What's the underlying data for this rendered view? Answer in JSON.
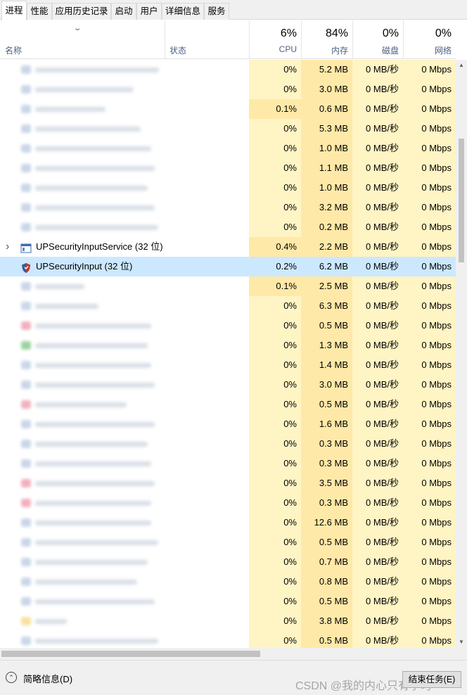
{
  "tabs": [
    {
      "label": "进程",
      "active": true
    },
    {
      "label": "性能"
    },
    {
      "label": "应用历史记录"
    },
    {
      "label": "启动"
    },
    {
      "label": "用户"
    },
    {
      "label": "详细信息"
    },
    {
      "label": "服务"
    }
  ],
  "header": {
    "name_label": "名称",
    "status_label": "状态",
    "cpu": {
      "pct": "6%",
      "label": "CPU"
    },
    "mem": {
      "pct": "84%",
      "label": "内存"
    },
    "disk": {
      "pct": "0%",
      "label": "磁盘"
    },
    "net": {
      "pct": "0%",
      "label": "网络"
    }
  },
  "rows": [
    {
      "cpu": "0%",
      "mem": "5.2 MB",
      "disk": "0 MB/秒",
      "net": "0 Mbps",
      "blurred": true
    },
    {
      "cpu": "0%",
      "mem": "3.0 MB",
      "disk": "0 MB/秒",
      "net": "0 Mbps",
      "blurred": true
    },
    {
      "cpu": "0.1%",
      "mem": "0.6 MB",
      "disk": "0 MB/秒",
      "net": "0 Mbps",
      "blurred": true
    },
    {
      "cpu": "0%",
      "mem": "5.3 MB",
      "disk": "0 MB/秒",
      "net": "0 Mbps",
      "blurred": true
    },
    {
      "cpu": "0%",
      "mem": "1.0 MB",
      "disk": "0 MB/秒",
      "net": "0 Mbps",
      "blurred": true
    },
    {
      "cpu": "0%",
      "mem": "1.1 MB",
      "disk": "0 MB/秒",
      "net": "0 Mbps",
      "blurred": true
    },
    {
      "cpu": "0%",
      "mem": "1.0 MB",
      "disk": "0 MB/秒",
      "net": "0 Mbps",
      "blurred": true
    },
    {
      "cpu": "0%",
      "mem": "3.2 MB",
      "disk": "0 MB/秒",
      "net": "0 Mbps",
      "blurred": true
    },
    {
      "cpu": "0%",
      "mem": "0.2 MB",
      "disk": "0 MB/秒",
      "net": "0 Mbps",
      "blurred": true
    },
    {
      "name": "UPSecurityInputService (32 位)",
      "icon": "service-window-icon",
      "expandable": true,
      "cpu": "0.4%",
      "mem": "2.2 MB",
      "disk": "0 MB/秒",
      "net": "0 Mbps"
    },
    {
      "name": "UPSecurityInput (32 位)",
      "icon": "shield-icon",
      "selected": true,
      "cpu": "0.2%",
      "mem": "6.2 MB",
      "disk": "0 MB/秒",
      "net": "0 Mbps"
    },
    {
      "cpu": "0.1%",
      "mem": "2.5 MB",
      "disk": "0 MB/秒",
      "net": "0 Mbps",
      "blurred": true
    },
    {
      "cpu": "0%",
      "mem": "6.3 MB",
      "disk": "0 MB/秒",
      "net": "0 Mbps",
      "blurred": true
    },
    {
      "cpu": "0%",
      "mem": "0.5 MB",
      "disk": "0 MB/秒",
      "net": "0 Mbps",
      "blurred": true,
      "tint": "#e8708a"
    },
    {
      "cpu": "0%",
      "mem": "1.3 MB",
      "disk": "0 MB/秒",
      "net": "0 Mbps",
      "blurred": true,
      "tint": "#4caf50"
    },
    {
      "cpu": "0%",
      "mem": "1.4 MB",
      "disk": "0 MB/秒",
      "net": "0 Mbps",
      "blurred": true
    },
    {
      "cpu": "0%",
      "mem": "3.0 MB",
      "disk": "0 MB/秒",
      "net": "0 Mbps",
      "blurred": true
    },
    {
      "cpu": "0%",
      "mem": "0.5 MB",
      "disk": "0 MB/秒",
      "net": "0 Mbps",
      "blurred": true,
      "tint": "#e8708a"
    },
    {
      "cpu": "0%",
      "mem": "1.6 MB",
      "disk": "0 MB/秒",
      "net": "0 Mbps",
      "blurred": true
    },
    {
      "cpu": "0%",
      "mem": "0.3 MB",
      "disk": "0 MB/秒",
      "net": "0 Mbps",
      "blurred": true
    },
    {
      "cpu": "0%",
      "mem": "0.3 MB",
      "disk": "0 MB/秒",
      "net": "0 Mbps",
      "blurred": true
    },
    {
      "cpu": "0%",
      "mem": "3.5 MB",
      "disk": "0 MB/秒",
      "net": "0 Mbps",
      "blurred": true,
      "tint": "#e8708a"
    },
    {
      "cpu": "0%",
      "mem": "0.3 MB",
      "disk": "0 MB/秒",
      "net": "0 Mbps",
      "blurred": true,
      "tint": "#e8708a"
    },
    {
      "cpu": "0%",
      "mem": "12.6 MB",
      "disk": "0 MB/秒",
      "net": "0 Mbps",
      "blurred": true
    },
    {
      "cpu": "0%",
      "mem": "0.5 MB",
      "disk": "0 MB/秒",
      "net": "0 Mbps",
      "blurred": true
    },
    {
      "cpu": "0%",
      "mem": "0.7 MB",
      "disk": "0 MB/秒",
      "net": "0 Mbps",
      "blurred": true
    },
    {
      "cpu": "0%",
      "mem": "0.8 MB",
      "disk": "0 MB/秒",
      "net": "0 Mbps",
      "blurred": true
    },
    {
      "cpu": "0%",
      "mem": "0.5 MB",
      "disk": "0 MB/秒",
      "net": "0 Mbps",
      "blurred": true
    },
    {
      "cpu": "0%",
      "mem": "3.8 MB",
      "disk": "0 MB/秒",
      "net": "0 Mbps",
      "blurred": true,
      "tint": "#f2c94c"
    },
    {
      "cpu": "0%",
      "mem": "0.5 MB",
      "disk": "0 MB/秒",
      "net": "0 Mbps",
      "blurred": true
    }
  ],
  "footer": {
    "collapse_label": "简略信息(D)",
    "end_task_label": "结束任务(E)",
    "watermark": "CSDN @我的内心只有学习"
  },
  "colors": {
    "cell_light": "#fff4c4",
    "cell_mid": "#ffe9a8",
    "selected": "#cce8ff",
    "header_label": "#4d6082"
  }
}
